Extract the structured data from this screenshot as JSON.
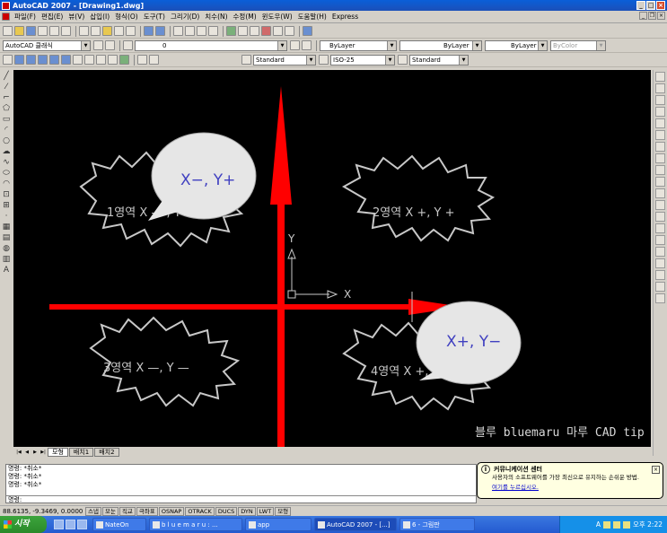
{
  "window": {
    "title": "AutoCAD 2007 - [Drawing1.dwg]"
  },
  "menu": [
    "파일(F)",
    "편집(E)",
    "뷰(V)",
    "삽입(I)",
    "형식(O)",
    "도구(T)",
    "그리기(D)",
    "치수(N)",
    "수정(M)",
    "윈도우(W)",
    "도움말(H)",
    "Express"
  ],
  "toolbar": {
    "workspace": "AutoCAD 클래식",
    "layer": "0",
    "color": "ByLayer",
    "linetype": "ByLayer",
    "lineweight": "ByLayer",
    "plotstyle": "ByColor",
    "textstyle": "Standard",
    "dimstyle": "ISO-25",
    "tablestyle": "Standard"
  },
  "drawing": {
    "axis_y": "Y",
    "axis_x": "X",
    "q1": "1영역 X — , Y +",
    "q2": "2영역 X +, Y +",
    "q3": "3영역 X —, Y —",
    "q4": "4영역 X +, Y —",
    "bubble_left": "X−, Y+",
    "bubble_right": "X+, Y−",
    "watermark": "블루 bluemaru 마루 CAD tip",
    "colors": {
      "arrow": "#ff0000",
      "burst": "#c8c8c8",
      "bubble_text": "#4040c0"
    }
  },
  "tabs": [
    "모형",
    "배치1",
    "배치2"
  ],
  "command": {
    "lines": [
      "명령: *취소*",
      "명령: *취소*",
      "명령: *취소*"
    ],
    "prompt": "명령:"
  },
  "balloon": {
    "title": "커뮤니케이션 센터",
    "body": "사용자의 소프트웨어를 가장 최신으로 유지하는 손쉬운 방법.",
    "link": "여기를 누르십시오."
  },
  "status": {
    "coords": "88.6135, -9.3469, 0.0000",
    "buttons": [
      "스냅",
      "모눈",
      "직교",
      "극좌표",
      "OSNAP",
      "OTRACK",
      "DUCS",
      "DYN",
      "LWT",
      "모형"
    ]
  },
  "taskbar": {
    "start": "시작",
    "tasks": [
      "NateOn",
      "b l u e m a r u : ...",
      "app",
      "AutoCAD 2007 - [...]",
      "6 - 그림판"
    ],
    "clock": "오후 2:22"
  }
}
